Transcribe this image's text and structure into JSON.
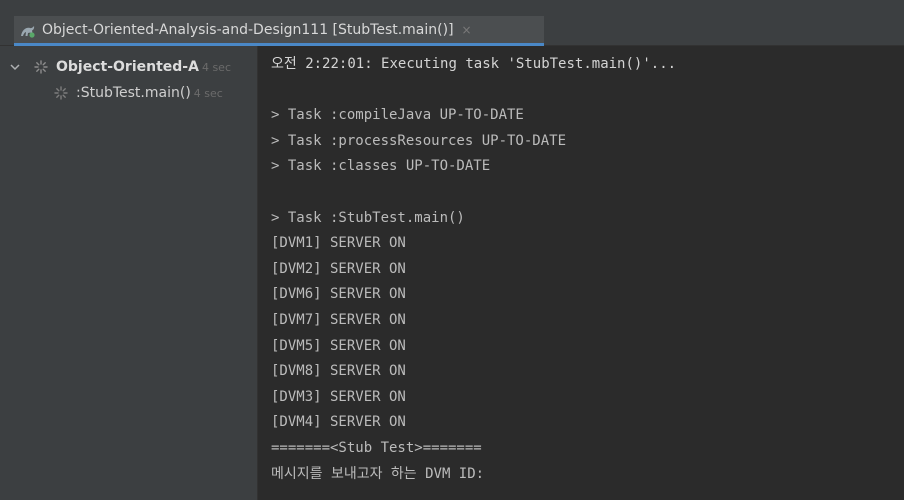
{
  "tab": {
    "title": "Object-Oriented-Analysis-and-Design111 [StubTest.main()]",
    "close_glyph": "×"
  },
  "tree": {
    "root": {
      "label": "Object-Oriented-A",
      "duration": "4 sec"
    },
    "child": {
      "label": ":StubTest.main()",
      "duration": "4 sec"
    }
  },
  "console": {
    "lines": [
      "오전 2:22:01: Executing task 'StubTest.main()'...",
      "",
      "> Task :compileJava UP-TO-DATE",
      "> Task :processResources UP-TO-DATE",
      "> Task :classes UP-TO-DATE",
      "",
      "> Task :StubTest.main()",
      "[DVM1] SERVER ON",
      "[DVM2] SERVER ON",
      "[DVM6] SERVER ON",
      "[DVM7] SERVER ON",
      "[DVM5] SERVER ON",
      "[DVM8] SERVER ON",
      "[DVM3] SERVER ON",
      "[DVM4] SERVER ON",
      "=======<Stub Test>=======",
      "메시지를 보내고자 하는 DVM ID:"
    ]
  },
  "colors": {
    "background": "#2b2b2b",
    "panel": "#3c3f41",
    "accent": "#4a88c7",
    "text": "#bbbbbb"
  },
  "icons": {
    "tab": "gradle-run-icon",
    "expand": "chevron-down-icon",
    "status": "spinner-icon"
  }
}
